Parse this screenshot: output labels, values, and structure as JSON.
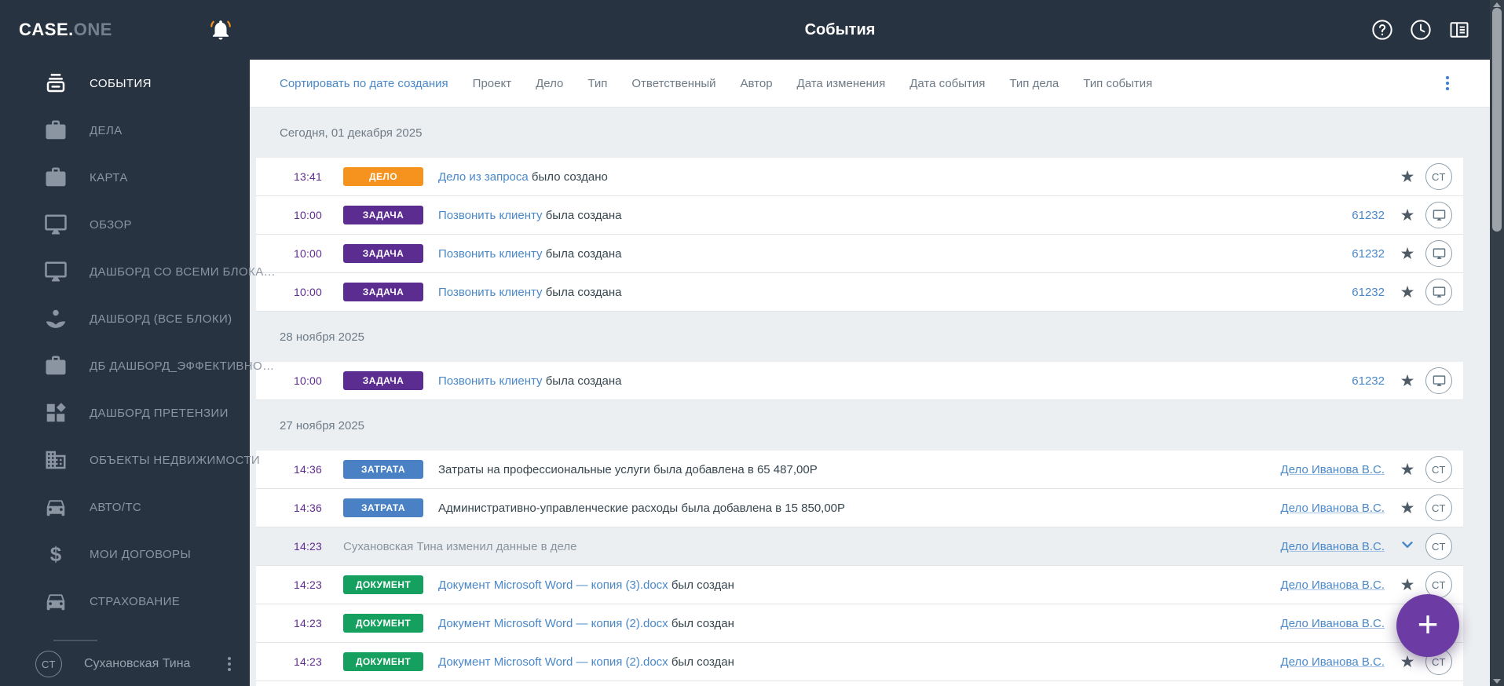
{
  "topbar": {
    "logo_primary": "CASE.",
    "logo_secondary": "ONE",
    "title": "События",
    "icons": [
      "help-icon",
      "history-icon",
      "layout-columns-icon"
    ]
  },
  "sidebar": {
    "items": [
      {
        "key": "events",
        "label": "СОБЫТИЯ",
        "icon": "events-icon",
        "active": true
      },
      {
        "key": "cases",
        "label": "ДЕЛА",
        "icon": "briefcase-icon",
        "active": false
      },
      {
        "key": "map",
        "label": "КАРТА",
        "icon": "briefcase-icon",
        "active": false
      },
      {
        "key": "overview",
        "label": "ОБЗОР",
        "icon": "monitor-icon",
        "active": false
      },
      {
        "key": "dashboard-all-blocks",
        "label": "ДАШБОРД СО ВСЕМИ БЛОКА…",
        "icon": "monitor-icon",
        "active": false
      },
      {
        "key": "dashboard-vse-bloki",
        "label": "ДАШБОРД (ВСЕ БЛОКИ)",
        "icon": "spa-icon",
        "active": false
      },
      {
        "key": "db-dashboard-effect",
        "label": "ДБ ДАШБОРД_ЭФФЕКТИВНО…",
        "icon": "briefcase-icon",
        "active": false
      },
      {
        "key": "dashboard-pretenzii",
        "label": "ДАШБОРД ПРЕТЕНЗИИ",
        "icon": "dashboard-icon",
        "active": false
      },
      {
        "key": "real-estate",
        "label": "ОБЪЕКТЫ НЕДВИЖИМОСТИ",
        "icon": "building-icon",
        "active": false
      },
      {
        "key": "auto",
        "label": "АВТО/ТС",
        "icon": "car-icon",
        "active": false
      },
      {
        "key": "contracts",
        "label": "МОИ ДОГОВОРЫ",
        "icon": "dollar-icon",
        "active": false
      },
      {
        "key": "insurance",
        "label": "СТРАХОВАНИЕ",
        "icon": "car-icon",
        "active": false
      }
    ],
    "user": {
      "initials": "СТ",
      "name": "Сухановская Тина"
    }
  },
  "filters": {
    "items": [
      {
        "key": "sort-by-created",
        "label": "Сортировать по дате создания",
        "primary": true
      },
      {
        "key": "project",
        "label": "Проект"
      },
      {
        "key": "case",
        "label": "Дело"
      },
      {
        "key": "type",
        "label": "Тип"
      },
      {
        "key": "responsible",
        "label": "Ответственный"
      },
      {
        "key": "author",
        "label": "Автор"
      },
      {
        "key": "date-modified",
        "label": "Дата изменения"
      },
      {
        "key": "date-event",
        "label": "Дата события"
      },
      {
        "key": "case-type",
        "label": "Тип дела"
      },
      {
        "key": "event-type",
        "label": "Тип события"
      }
    ]
  },
  "colors": {
    "header_dark": "#273341",
    "accent_blue": "#4A88C8",
    "time_purple": "#5E2C90",
    "badge_delo": "#F6921E",
    "badge_zadacha": "#5C2D91",
    "badge_zatrata": "#4A81C4",
    "badge_dokument": "#16A05F",
    "fab_purple": "#6C3CA4"
  },
  "list": {
    "groups": [
      {
        "label": "Сегодня, 01 декабря 2025",
        "events": [
          {
            "time": "13:41",
            "badge": "ДЕЛО",
            "badge_color": "#F6921E",
            "link": "Дело из запроса",
            "text": "было создано",
            "star": true,
            "avatar": "СТ"
          },
          {
            "time": "10:00",
            "badge": "ЗАДАЧА",
            "badge_color": "#5C2D91",
            "link": "Позвонить клиенту",
            "text": "была создана",
            "number_link": "61232",
            "star": true,
            "avatar": "monitor"
          },
          {
            "time": "10:00",
            "badge": "ЗАДАЧА",
            "badge_color": "#5C2D91",
            "link": "Позвонить клиенту",
            "text": "была создана",
            "number_link": "61232",
            "star": true,
            "avatar": "monitor"
          },
          {
            "time": "10:00",
            "badge": "ЗАДАЧА",
            "badge_color": "#5C2D91",
            "link": "Позвонить клиенту",
            "text": "была создана",
            "number_link": "61232",
            "star": true,
            "avatar": "monitor"
          }
        ]
      },
      {
        "label": "28 ноября 2025",
        "events": [
          {
            "time": "10:00",
            "badge": "ЗАДАЧА",
            "badge_color": "#5C2D91",
            "link": "Позвонить клиенту",
            "text": "была создана",
            "number_link": "61232",
            "star": true,
            "avatar": "monitor"
          }
        ]
      },
      {
        "label": "27 ноября 2025",
        "events": [
          {
            "time": "14:36",
            "badge": "ЗАТРАТА",
            "badge_color": "#4A81C4",
            "text": "Затраты на профессиональные услуги была добавлена в 65 487,00Р",
            "case_link": "Дело Иванова В.С.",
            "star": true,
            "avatar": "СТ"
          },
          {
            "time": "14:36",
            "badge": "ЗАТРАТА",
            "badge_color": "#4A81C4",
            "text": "Административно-управленческие расходы была добавлена в 15 850,00Р",
            "case_link": "Дело Иванова В.С.",
            "star": true,
            "avatar": "СТ"
          },
          {
            "time": "14:23",
            "muted_text": "Сухановская Тина изменил данные в деле",
            "case_link": "Дело Иванова В.С.",
            "chevron": true,
            "avatar": "СТ",
            "highlight": true
          },
          {
            "time": "14:23",
            "badge": "ДОКУМЕНТ",
            "badge_color": "#16A05F",
            "link": "Документ Microsoft Word — копия (3).docx",
            "text": "был создан",
            "case_link": "Дело Иванова В.С.",
            "star": true,
            "avatar": "СТ"
          },
          {
            "time": "14:23",
            "badge": "ДОКУМЕНТ",
            "badge_color": "#16A05F",
            "link": "Документ Microsoft Word — копия (2).docx",
            "text": "был создан",
            "case_link": "Дело Иванова В.С.",
            "star": true,
            "avatar": "СТ"
          },
          {
            "time": "14:23",
            "badge": "ДОКУМЕНТ",
            "badge_color": "#16A05F",
            "link": "Документ Microsoft Word — копия (2).docx",
            "text": "был создан",
            "case_link": "Дело Иванова В.С.",
            "star": true,
            "avatar": "СТ"
          }
        ]
      }
    ]
  },
  "fab": {
    "label": "+"
  }
}
